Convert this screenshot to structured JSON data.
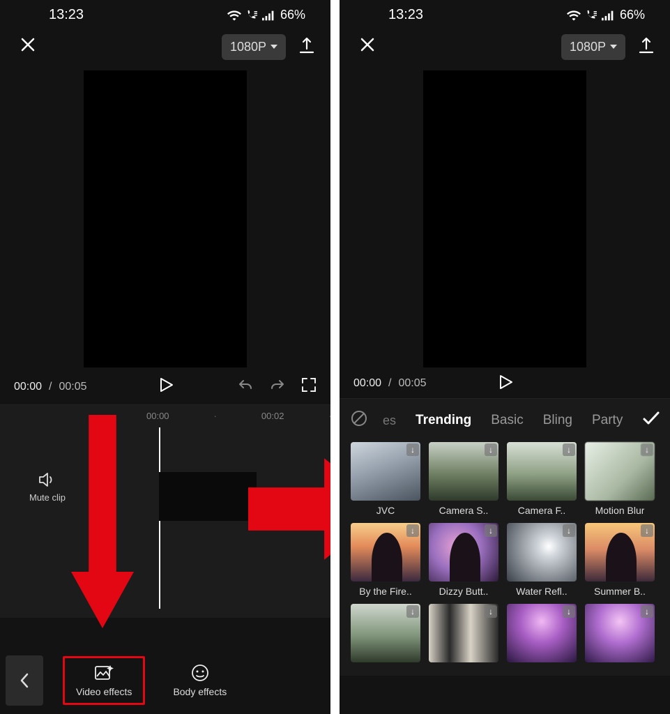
{
  "status": {
    "time": "13:23",
    "battery": "66%"
  },
  "header": {
    "resolution": "1080P"
  },
  "playback": {
    "current": "00:00",
    "total": "00:05"
  },
  "timeline": {
    "ticks": [
      "00:00",
      "00:02"
    ],
    "mute_label": "Mute clip"
  },
  "bottom": {
    "video_effects": "Video effects",
    "body_effects": "Body effects"
  },
  "effects": {
    "tabs_fragment": "es",
    "tabs": [
      "Trending",
      "Basic",
      "Bling",
      "Party"
    ],
    "active_tab": "Trending",
    "items": [
      {
        "label": "JVC"
      },
      {
        "label": "Camera S.."
      },
      {
        "label": "Camera F.."
      },
      {
        "label": "Motion Blur"
      },
      {
        "label": "By the Fire.."
      },
      {
        "label": "Dizzy Butt.."
      },
      {
        "label": "Water Refl.."
      },
      {
        "label": "Summer B.."
      },
      {
        "label": ""
      },
      {
        "label": ""
      },
      {
        "label": ""
      },
      {
        "label": ""
      }
    ]
  }
}
